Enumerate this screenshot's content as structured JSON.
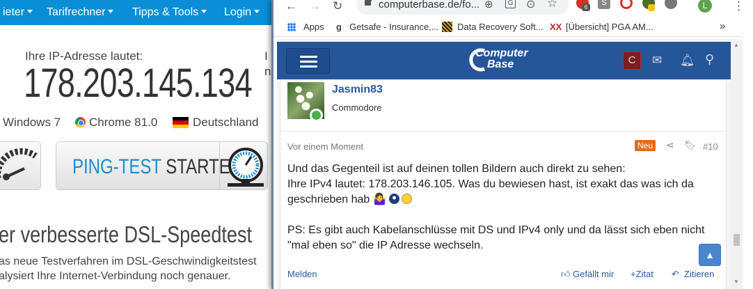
{
  "bg": {
    "nav": [
      {
        "label": "ieter"
      },
      {
        "label": "Tarifrechner"
      },
      {
        "label": "Tipps & Tools"
      },
      {
        "label": "Login"
      }
    ],
    "ip_label": "Ihre IP-Adresse lautet:",
    "ip_value": "178.203.145.134",
    "cut_right_1": "I",
    "cut_right_2": "n",
    "os": "Windows 7",
    "browser": "Chrome 81.0",
    "country": "Deutschland",
    "ping_part1": "PING-TEST",
    "ping_part2": "STARTEN",
    "heading": "er verbesserte DSL-Speedtest",
    "para_1": "as neue Testverfahren im DSL-Geschwindigkeitstest",
    "para_2": "alysiert Ihre Internet-Verbindung noch genauer."
  },
  "browser": {
    "url": "computerbase.de/fo...",
    "profile_initial": "L",
    "bookmarks": [
      {
        "label": "Apps"
      },
      {
        "label": "Getsafe - Insurance,..."
      },
      {
        "label": "Data Recovery Soft..."
      },
      {
        "label": "[Übersicht] PGA AM..."
      }
    ],
    "more": "»"
  },
  "site": {
    "logo_top": "Computer",
    "logo_bottom": "Base",
    "user_initial": "C"
  },
  "post": {
    "username": "Jasmin83",
    "user_title": "Commodore",
    "time": "Vor einem Moment",
    "badge": "Neu",
    "number": "#10",
    "lines": [
      "Und das Gegenteil ist auf deinen tollen Bildern auch direkt zu sehen:",
      "Ihre IPv4 lautet: 178.203.146.105. Was du bewiesen hast, ist exakt das was ich da",
      "geschrieben hab 🤷‍♀️",
      "",
      "PS: Es gibt auch Kabelanschlüsse mit DS und IPv4 only und da lässt sich eben nicht",
      "\"mal eben so\" die IP Adresse wechseln."
    ],
    "report": "Melden",
    "like": "Gefällt mir",
    "quote": "+Zitat",
    "reply": "Zitieren"
  }
}
